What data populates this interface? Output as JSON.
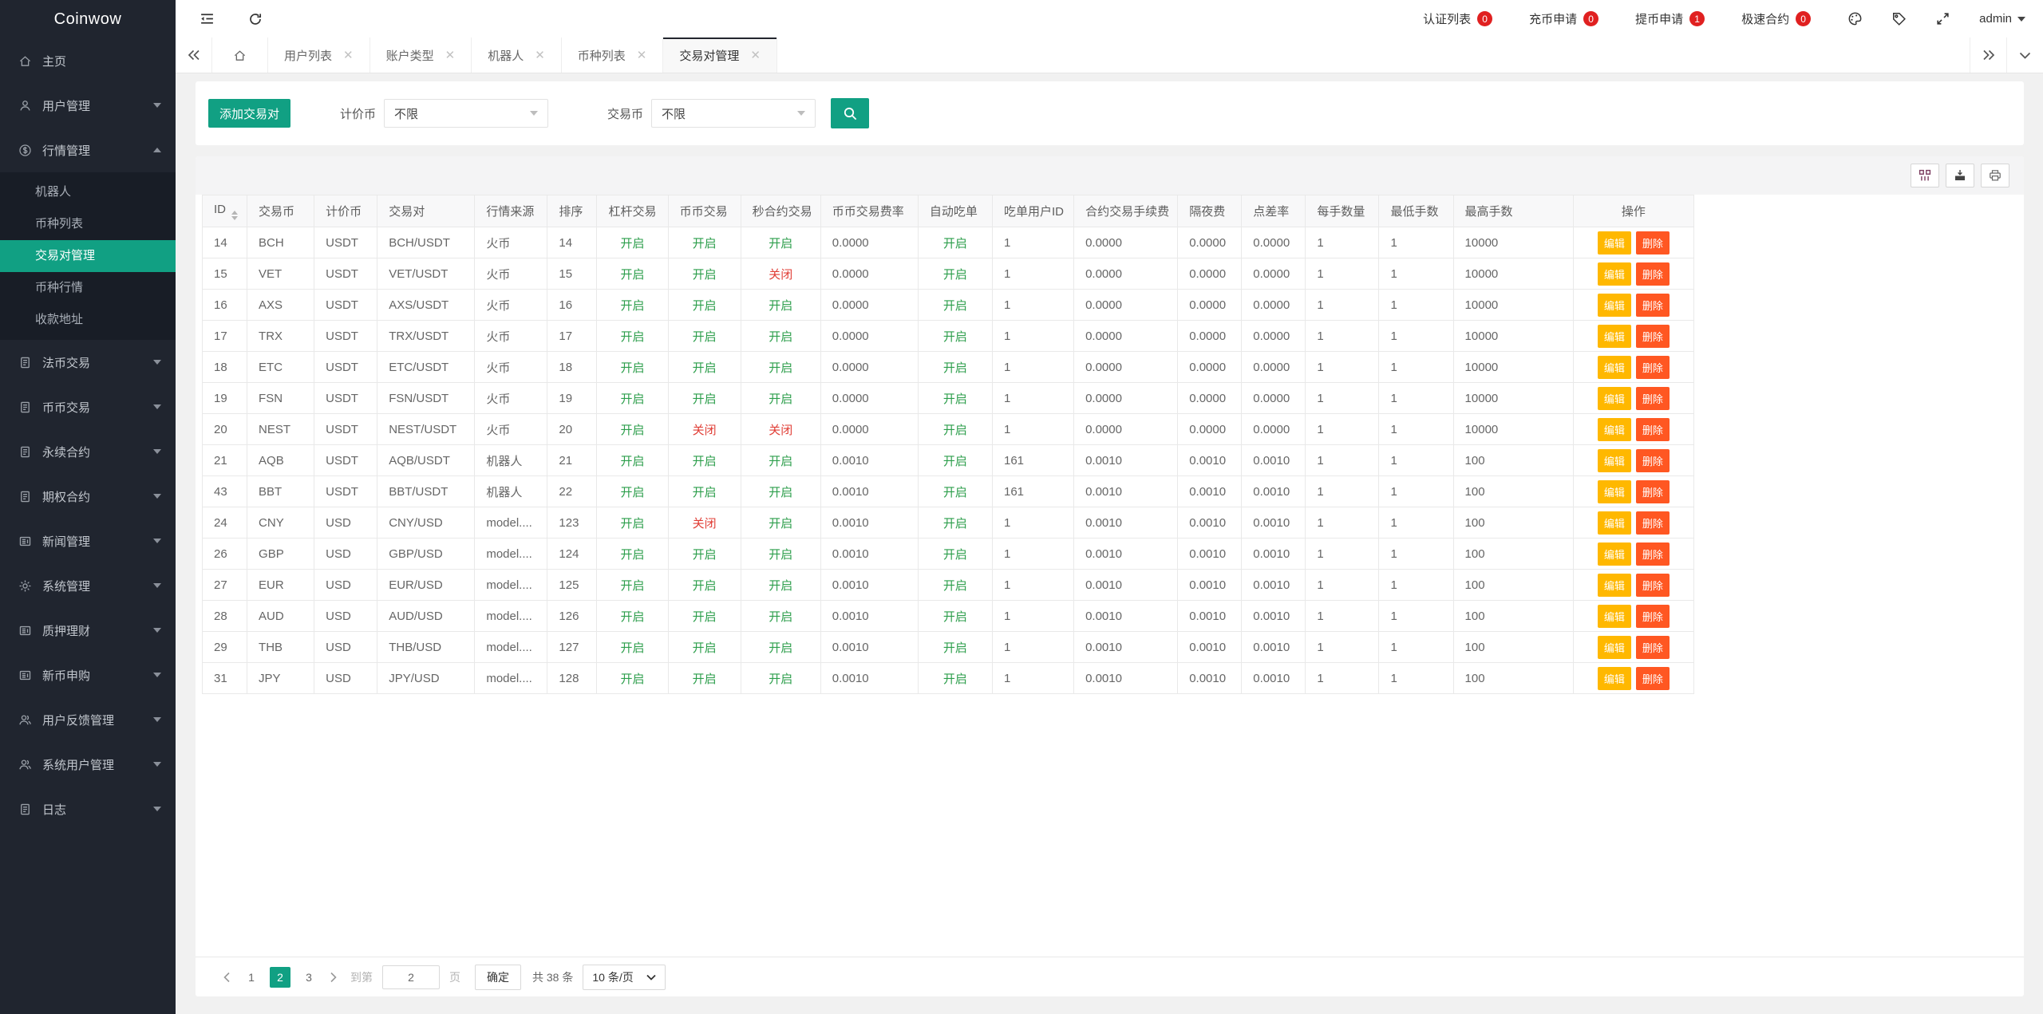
{
  "app": {
    "name": "Coinwow"
  },
  "colors": {
    "accent": "#11a083",
    "status_on": "#2c9e4b",
    "status_off": "#e03e36",
    "edit_button": "#ffb800",
    "delete_button": "#ff5722",
    "badge": "#e02020",
    "sidebar_bg": "#20252f"
  },
  "topbar": {
    "badges": [
      {
        "label": "认证列表",
        "count": "0"
      },
      {
        "label": "充币申请",
        "count": "0"
      },
      {
        "label": "提币申请",
        "count": "1"
      },
      {
        "label": "极速合约",
        "count": "0"
      }
    ],
    "user": "admin"
  },
  "tabs": {
    "items": [
      {
        "label": "用户列表",
        "active": false
      },
      {
        "label": "账户类型",
        "active": false
      },
      {
        "label": "机器人",
        "active": false
      },
      {
        "label": "币种列表",
        "active": false
      },
      {
        "label": "交易对管理",
        "active": true
      }
    ]
  },
  "sidebar": {
    "items": [
      {
        "icon": "home-icon",
        "label": "主页",
        "expandable": false
      },
      {
        "icon": "user-icon",
        "label": "用户管理",
        "expandable": true
      },
      {
        "icon": "dollar-icon",
        "label": "行情管理",
        "expandable": true,
        "open": true,
        "children": [
          {
            "label": "机器人",
            "active": false
          },
          {
            "label": "币种列表",
            "active": false
          },
          {
            "label": "交易对管理",
            "active": true
          },
          {
            "label": "币种行情",
            "active": false
          },
          {
            "label": "收款地址",
            "active": false
          }
        ]
      },
      {
        "icon": "doc-icon",
        "label": "法币交易",
        "expandable": true
      },
      {
        "icon": "doc-icon",
        "label": "币币交易",
        "expandable": true
      },
      {
        "icon": "doc-icon",
        "label": "永续合约",
        "expandable": true
      },
      {
        "icon": "doc-icon",
        "label": "期权合约",
        "expandable": true
      },
      {
        "icon": "news-icon",
        "label": "新闻管理",
        "expandable": true
      },
      {
        "icon": "gear-icon",
        "label": "系统管理",
        "expandable": true
      },
      {
        "icon": "news-icon",
        "label": "质押理财",
        "expandable": true
      },
      {
        "icon": "news-icon",
        "label": "新币申购",
        "expandable": true
      },
      {
        "icon": "people-icon",
        "label": "用户反馈管理",
        "expandable": true
      },
      {
        "icon": "people-icon",
        "label": "系统用户管理",
        "expandable": true
      },
      {
        "icon": "doc-icon",
        "label": "日志",
        "expandable": true
      }
    ]
  },
  "filters": {
    "add_button": "添加交易对",
    "quote_label": "计价币",
    "quote_value": "不限",
    "base_label": "交易币",
    "base_value": "不限"
  },
  "table": {
    "columns": [
      "ID",
      "交易币",
      "计价币",
      "交易对",
      "行情来源",
      "排序",
      "杠杆交易",
      "币币交易",
      "秒合约交易",
      "币币交易费率",
      "自动吃单",
      "吃单用户ID",
      "合约交易手续费",
      "隔夜费",
      "点差率",
      "每手数量",
      "最低手数",
      "最高手数",
      "操作"
    ],
    "status_on": "开启",
    "status_off": "关闭",
    "actions": {
      "edit": "编辑",
      "delete": "删除"
    },
    "rows": [
      [
        "14",
        "BCH",
        "USDT",
        "BCH/USDT",
        "火币",
        "14",
        "开启",
        "开启",
        "开启",
        "0.0000",
        "开启",
        "1",
        "0.0000",
        "0.0000",
        "0.0000",
        "1",
        "1",
        "10000"
      ],
      [
        "15",
        "VET",
        "USDT",
        "VET/USDT",
        "火币",
        "15",
        "开启",
        "开启",
        "关闭",
        "0.0000",
        "开启",
        "1",
        "0.0000",
        "0.0000",
        "0.0000",
        "1",
        "1",
        "10000"
      ],
      [
        "16",
        "AXS",
        "USDT",
        "AXS/USDT",
        "火币",
        "16",
        "开启",
        "开启",
        "开启",
        "0.0000",
        "开启",
        "1",
        "0.0000",
        "0.0000",
        "0.0000",
        "1",
        "1",
        "10000"
      ],
      [
        "17",
        "TRX",
        "USDT",
        "TRX/USDT",
        "火币",
        "17",
        "开启",
        "开启",
        "开启",
        "0.0000",
        "开启",
        "1",
        "0.0000",
        "0.0000",
        "0.0000",
        "1",
        "1",
        "10000"
      ],
      [
        "18",
        "ETC",
        "USDT",
        "ETC/USDT",
        "火币",
        "18",
        "开启",
        "开启",
        "开启",
        "0.0000",
        "开启",
        "1",
        "0.0000",
        "0.0000",
        "0.0000",
        "1",
        "1",
        "10000"
      ],
      [
        "19",
        "FSN",
        "USDT",
        "FSN/USDT",
        "火币",
        "19",
        "开启",
        "开启",
        "开启",
        "0.0000",
        "开启",
        "1",
        "0.0000",
        "0.0000",
        "0.0000",
        "1",
        "1",
        "10000"
      ],
      [
        "20",
        "NEST",
        "USDT",
        "NEST/USDT",
        "火币",
        "20",
        "开启",
        "关闭",
        "关闭",
        "0.0000",
        "开启",
        "1",
        "0.0000",
        "0.0000",
        "0.0000",
        "1",
        "1",
        "10000"
      ],
      [
        "21",
        "AQB",
        "USDT",
        "AQB/USDT",
        "机器人",
        "21",
        "开启",
        "开启",
        "开启",
        "0.0010",
        "开启",
        "161",
        "0.0010",
        "0.0010",
        "0.0010",
        "1",
        "1",
        "100"
      ],
      [
        "43",
        "BBT",
        "USDT",
        "BBT/USDT",
        "机器人",
        "22",
        "开启",
        "开启",
        "开启",
        "0.0010",
        "开启",
        "161",
        "0.0010",
        "0.0010",
        "0.0010",
        "1",
        "1",
        "100"
      ],
      [
        "24",
        "CNY",
        "USD",
        "CNY/USD",
        "model....",
        "123",
        "开启",
        "关闭",
        "开启",
        "0.0010",
        "开启",
        "1",
        "0.0010",
        "0.0010",
        "0.0010",
        "1",
        "1",
        "100"
      ],
      [
        "26",
        "GBP",
        "USD",
        "GBP/USD",
        "model....",
        "124",
        "开启",
        "开启",
        "开启",
        "0.0010",
        "开启",
        "1",
        "0.0010",
        "0.0010",
        "0.0010",
        "1",
        "1",
        "100"
      ],
      [
        "27",
        "EUR",
        "USD",
        "EUR/USD",
        "model....",
        "125",
        "开启",
        "开启",
        "开启",
        "0.0010",
        "开启",
        "1",
        "0.0010",
        "0.0010",
        "0.0010",
        "1",
        "1",
        "100"
      ],
      [
        "28",
        "AUD",
        "USD",
        "AUD/USD",
        "model....",
        "126",
        "开启",
        "开启",
        "开启",
        "0.0010",
        "开启",
        "1",
        "0.0010",
        "0.0010",
        "0.0010",
        "1",
        "1",
        "100"
      ],
      [
        "29",
        "THB",
        "USD",
        "THB/USD",
        "model....",
        "127",
        "开启",
        "开启",
        "开启",
        "0.0010",
        "开启",
        "1",
        "0.0010",
        "0.0010",
        "0.0010",
        "1",
        "1",
        "100"
      ],
      [
        "31",
        "JPY",
        "USD",
        "JPY/USD",
        "model....",
        "128",
        "开启",
        "开启",
        "开启",
        "0.0010",
        "开启",
        "1",
        "0.0010",
        "0.0010",
        "0.0010",
        "1",
        "1",
        "100"
      ]
    ]
  },
  "pagination": {
    "pages": [
      {
        "label": "1",
        "active": false
      },
      {
        "label": "2",
        "active": true
      },
      {
        "label": "3",
        "active": false
      }
    ],
    "jump_prefix": "到第",
    "jump_value": "2",
    "jump_suffix": "页",
    "confirm": "确定",
    "total": "共 38 条",
    "page_size": "10 条/页"
  }
}
